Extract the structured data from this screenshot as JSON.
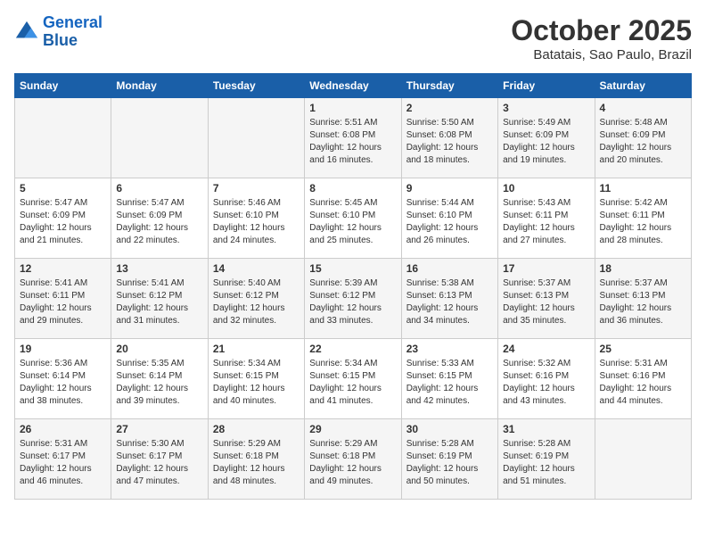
{
  "logo": {
    "line1": "General",
    "line2": "Blue"
  },
  "title": "October 2025",
  "location": "Batatais, Sao Paulo, Brazil",
  "days_of_week": [
    "Sunday",
    "Monday",
    "Tuesday",
    "Wednesday",
    "Thursday",
    "Friday",
    "Saturday"
  ],
  "weeks": [
    [
      {
        "day": "",
        "info": ""
      },
      {
        "day": "",
        "info": ""
      },
      {
        "day": "",
        "info": ""
      },
      {
        "day": "1",
        "info": "Sunrise: 5:51 AM\nSunset: 6:08 PM\nDaylight: 12 hours\nand 16 minutes."
      },
      {
        "day": "2",
        "info": "Sunrise: 5:50 AM\nSunset: 6:08 PM\nDaylight: 12 hours\nand 18 minutes."
      },
      {
        "day": "3",
        "info": "Sunrise: 5:49 AM\nSunset: 6:09 PM\nDaylight: 12 hours\nand 19 minutes."
      },
      {
        "day": "4",
        "info": "Sunrise: 5:48 AM\nSunset: 6:09 PM\nDaylight: 12 hours\nand 20 minutes."
      }
    ],
    [
      {
        "day": "5",
        "info": "Sunrise: 5:47 AM\nSunset: 6:09 PM\nDaylight: 12 hours\nand 21 minutes."
      },
      {
        "day": "6",
        "info": "Sunrise: 5:47 AM\nSunset: 6:09 PM\nDaylight: 12 hours\nand 22 minutes."
      },
      {
        "day": "7",
        "info": "Sunrise: 5:46 AM\nSunset: 6:10 PM\nDaylight: 12 hours\nand 24 minutes."
      },
      {
        "day": "8",
        "info": "Sunrise: 5:45 AM\nSunset: 6:10 PM\nDaylight: 12 hours\nand 25 minutes."
      },
      {
        "day": "9",
        "info": "Sunrise: 5:44 AM\nSunset: 6:10 PM\nDaylight: 12 hours\nand 26 minutes."
      },
      {
        "day": "10",
        "info": "Sunrise: 5:43 AM\nSunset: 6:11 PM\nDaylight: 12 hours\nand 27 minutes."
      },
      {
        "day": "11",
        "info": "Sunrise: 5:42 AM\nSunset: 6:11 PM\nDaylight: 12 hours\nand 28 minutes."
      }
    ],
    [
      {
        "day": "12",
        "info": "Sunrise: 5:41 AM\nSunset: 6:11 PM\nDaylight: 12 hours\nand 29 minutes."
      },
      {
        "day": "13",
        "info": "Sunrise: 5:41 AM\nSunset: 6:12 PM\nDaylight: 12 hours\nand 31 minutes."
      },
      {
        "day": "14",
        "info": "Sunrise: 5:40 AM\nSunset: 6:12 PM\nDaylight: 12 hours\nand 32 minutes."
      },
      {
        "day": "15",
        "info": "Sunrise: 5:39 AM\nSunset: 6:12 PM\nDaylight: 12 hours\nand 33 minutes."
      },
      {
        "day": "16",
        "info": "Sunrise: 5:38 AM\nSunset: 6:13 PM\nDaylight: 12 hours\nand 34 minutes."
      },
      {
        "day": "17",
        "info": "Sunrise: 5:37 AM\nSunset: 6:13 PM\nDaylight: 12 hours\nand 35 minutes."
      },
      {
        "day": "18",
        "info": "Sunrise: 5:37 AM\nSunset: 6:13 PM\nDaylight: 12 hours\nand 36 minutes."
      }
    ],
    [
      {
        "day": "19",
        "info": "Sunrise: 5:36 AM\nSunset: 6:14 PM\nDaylight: 12 hours\nand 38 minutes."
      },
      {
        "day": "20",
        "info": "Sunrise: 5:35 AM\nSunset: 6:14 PM\nDaylight: 12 hours\nand 39 minutes."
      },
      {
        "day": "21",
        "info": "Sunrise: 5:34 AM\nSunset: 6:15 PM\nDaylight: 12 hours\nand 40 minutes."
      },
      {
        "day": "22",
        "info": "Sunrise: 5:34 AM\nSunset: 6:15 PM\nDaylight: 12 hours\nand 41 minutes."
      },
      {
        "day": "23",
        "info": "Sunrise: 5:33 AM\nSunset: 6:15 PM\nDaylight: 12 hours\nand 42 minutes."
      },
      {
        "day": "24",
        "info": "Sunrise: 5:32 AM\nSunset: 6:16 PM\nDaylight: 12 hours\nand 43 minutes."
      },
      {
        "day": "25",
        "info": "Sunrise: 5:31 AM\nSunset: 6:16 PM\nDaylight: 12 hours\nand 44 minutes."
      }
    ],
    [
      {
        "day": "26",
        "info": "Sunrise: 5:31 AM\nSunset: 6:17 PM\nDaylight: 12 hours\nand 46 minutes."
      },
      {
        "day": "27",
        "info": "Sunrise: 5:30 AM\nSunset: 6:17 PM\nDaylight: 12 hours\nand 47 minutes."
      },
      {
        "day": "28",
        "info": "Sunrise: 5:29 AM\nSunset: 6:18 PM\nDaylight: 12 hours\nand 48 minutes."
      },
      {
        "day": "29",
        "info": "Sunrise: 5:29 AM\nSunset: 6:18 PM\nDaylight: 12 hours\nand 49 minutes."
      },
      {
        "day": "30",
        "info": "Sunrise: 5:28 AM\nSunset: 6:19 PM\nDaylight: 12 hours\nand 50 minutes."
      },
      {
        "day": "31",
        "info": "Sunrise: 5:28 AM\nSunset: 6:19 PM\nDaylight: 12 hours\nand 51 minutes."
      },
      {
        "day": "",
        "info": ""
      }
    ]
  ]
}
